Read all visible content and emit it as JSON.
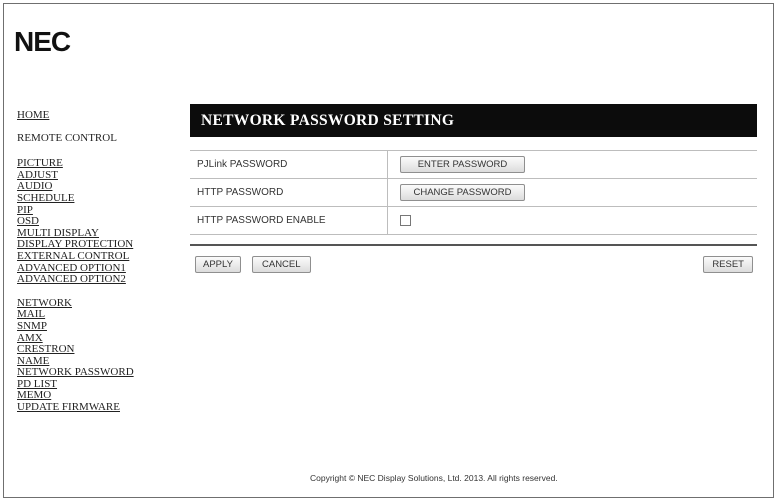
{
  "logo": {
    "text": "NEC"
  },
  "sidebar": {
    "group1": [
      "HOME",
      "REMOTE CONTROL"
    ],
    "group2": [
      "PICTURE",
      "ADJUST",
      "AUDIO",
      "SCHEDULE",
      "PIP",
      "OSD",
      "MULTI DISPLAY",
      "DISPLAY PROTECTION",
      "EXTERNAL CONTROL",
      "ADVANCED OPTION1",
      "ADVANCED OPTION2"
    ],
    "group3": [
      "NETWORK",
      "MAIL",
      "SNMP",
      "AMX",
      "CRESTRON",
      "NAME",
      "NETWORK PASSWORD",
      "PD LIST",
      "MEMO",
      "UPDATE FIRMWARE"
    ]
  },
  "main": {
    "title": "NETWORK PASSWORD SETTING",
    "rows": [
      {
        "label": "PJLink PASSWORD",
        "button": "ENTER PASSWORD"
      },
      {
        "label": "HTTP PASSWORD",
        "button": "CHANGE PASSWORD"
      },
      {
        "label": "HTTP PASSWORD ENABLE",
        "checked": false
      }
    ],
    "buttons": {
      "apply": "APPLY",
      "cancel": "CANCEL",
      "reset": "RESET"
    }
  },
  "footer": {
    "copyright": "Copyright © NEC Display Solutions, Ltd. 2013. All rights reserved."
  }
}
